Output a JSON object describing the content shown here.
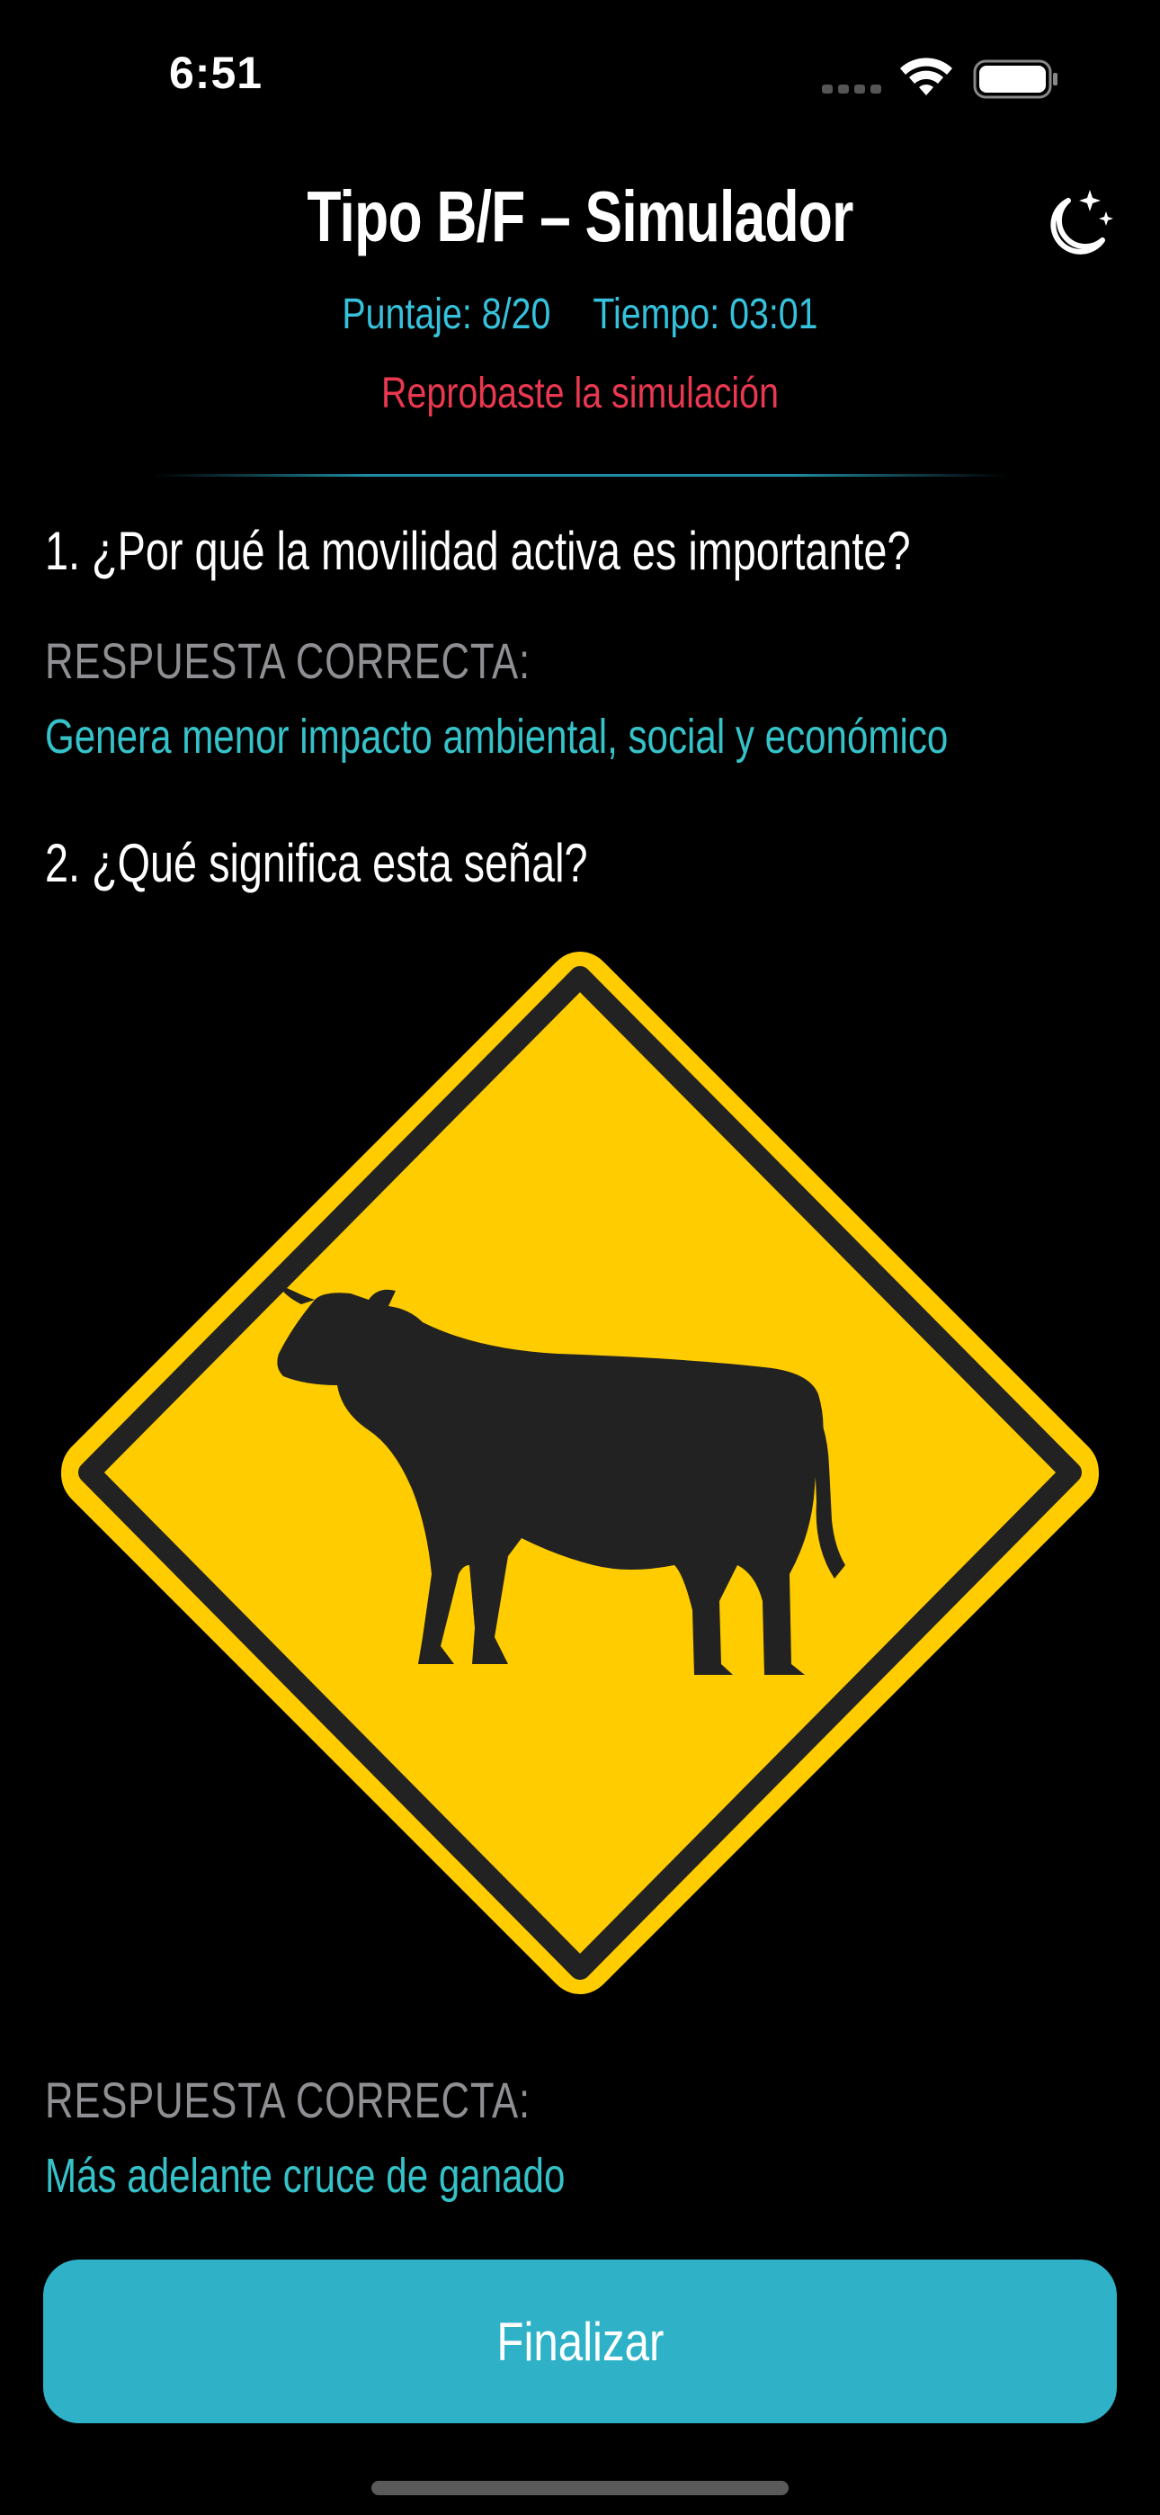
{
  "status_bar": {
    "time": "6:51"
  },
  "header": {
    "title": "Tipo B/F – Simulador",
    "score_label": "Puntaje: 8/20",
    "time_label": "Tiempo: 03:01",
    "result_message": "Reprobaste la simulación",
    "theme_icon": "moon-stars-icon"
  },
  "questions": [
    {
      "text": "1. ¿Por qué la movilidad activa es importante?",
      "answer_label": "RESPUESTA CORRECTA:",
      "answer": "Genera menor impacto ambiental, social y económico"
    },
    {
      "text": "2. ¿Qué significa esta señal?",
      "image": "cattle-crossing-sign",
      "answer_label": "RESPUESTA CORRECTA:",
      "answer": "Más adelante cruce de ganado"
    }
  ],
  "footer": {
    "finish_label": "Finalizar"
  },
  "colors": {
    "accent": "#2fb2c8",
    "answer": "#36c2c9",
    "fail": "#e9384f",
    "sign_yellow": "#ffcc00"
  }
}
